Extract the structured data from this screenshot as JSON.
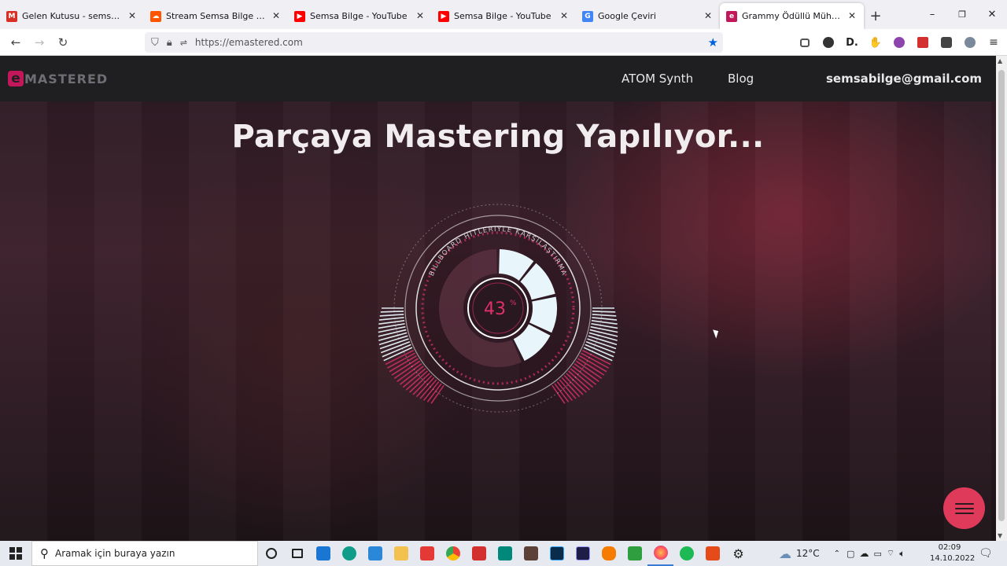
{
  "browser": {
    "tabs": [
      {
        "label": "Gelen Kutusu - semsabilge@gr",
        "icon": "gmail-icon",
        "color": "#d93025",
        "glyph": "M",
        "active": false
      },
      {
        "label": "Stream Semsa Bilge music | Lis",
        "icon": "soundcloud-icon",
        "color": "#ff5500",
        "glyph": "☁",
        "active": false
      },
      {
        "label": "Semsa Bilge - YouTube",
        "icon": "youtube-icon",
        "color": "#ff0000",
        "glyph": "▶",
        "active": false
      },
      {
        "label": "Semsa Bilge - YouTube",
        "icon": "youtube-icon",
        "color": "#ff0000",
        "glyph": "▶",
        "active": false
      },
      {
        "label": "Google Çeviri",
        "icon": "google-translate-icon",
        "color": "#4285f4",
        "glyph": "G",
        "active": false
      },
      {
        "label": "Grammy Ödüllü Mühendislerde",
        "icon": "emastered-icon",
        "color": "#c2185b",
        "glyph": "e",
        "active": true
      }
    ],
    "new_tab": "+",
    "url": "https://emastered.com",
    "window": {
      "minimize": "–",
      "restore": "❐",
      "close": "✕"
    }
  },
  "site": {
    "logo_mark": "e",
    "logo_word": "MASTERED",
    "nav": {
      "atom": "ATOM Synth",
      "blog": "Blog",
      "account": "semsabilge@gmail.com"
    },
    "headline": "Parçaya Mastering Yapılıyor...",
    "meter": {
      "progress_label": "43",
      "percent_sign": "%",
      "progress": 0.43,
      "ring_text": "BILLBOARD HITLERIYLE KARŞILAŞTIRMA",
      "accent": "#e0306a",
      "light": "#e8f6fb"
    }
  },
  "taskbar": {
    "search_placeholder": "Aramak için buraya yazın",
    "weather": "12°C",
    "time": "02:09",
    "date": "14.10.2022"
  }
}
